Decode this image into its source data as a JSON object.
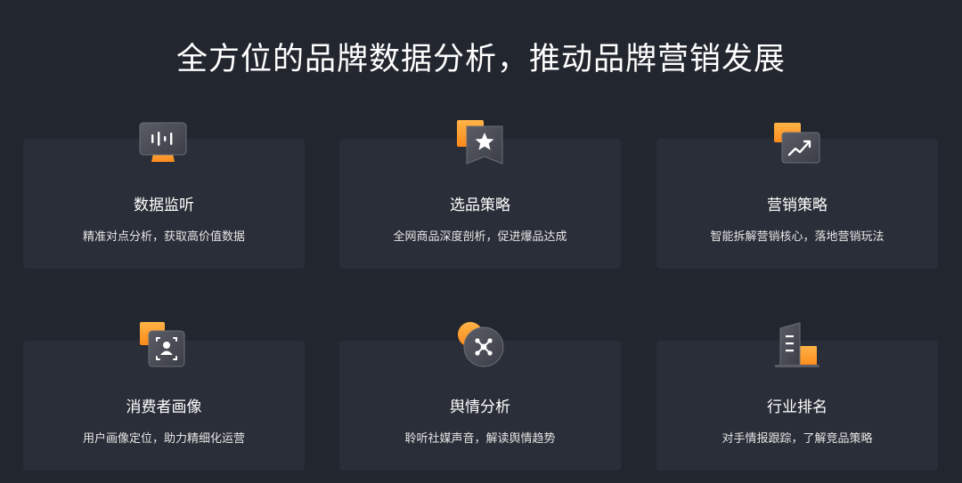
{
  "headline": "全方位的品牌数据分析，推动品牌营销发展",
  "colors": {
    "background": "#22262f",
    "card": "#2a2e38",
    "accent": "#ff9b28",
    "glass": "#4a4d55"
  },
  "features": [
    {
      "icon": "monitor-waveform-icon",
      "title": "数据监听",
      "desc": "精准对点分析，获取高价值数据"
    },
    {
      "icon": "star-bookmark-icon",
      "title": "选品策略",
      "desc": "全网商品深度剖析，促进爆品达成"
    },
    {
      "icon": "trend-chart-icon",
      "title": "营销策略",
      "desc": "智能拆解营销核心，落地营销玩法"
    },
    {
      "icon": "user-scan-icon",
      "title": "消费者画像",
      "desc": "用户画像定位，助力精细化运营"
    },
    {
      "icon": "network-nodes-icon",
      "title": "舆情分析",
      "desc": "聆听社媒声音，解读舆情趋势"
    },
    {
      "icon": "building-ranking-icon",
      "title": "行业排名",
      "desc": "对手情报跟踪，了解竞品策略"
    }
  ]
}
